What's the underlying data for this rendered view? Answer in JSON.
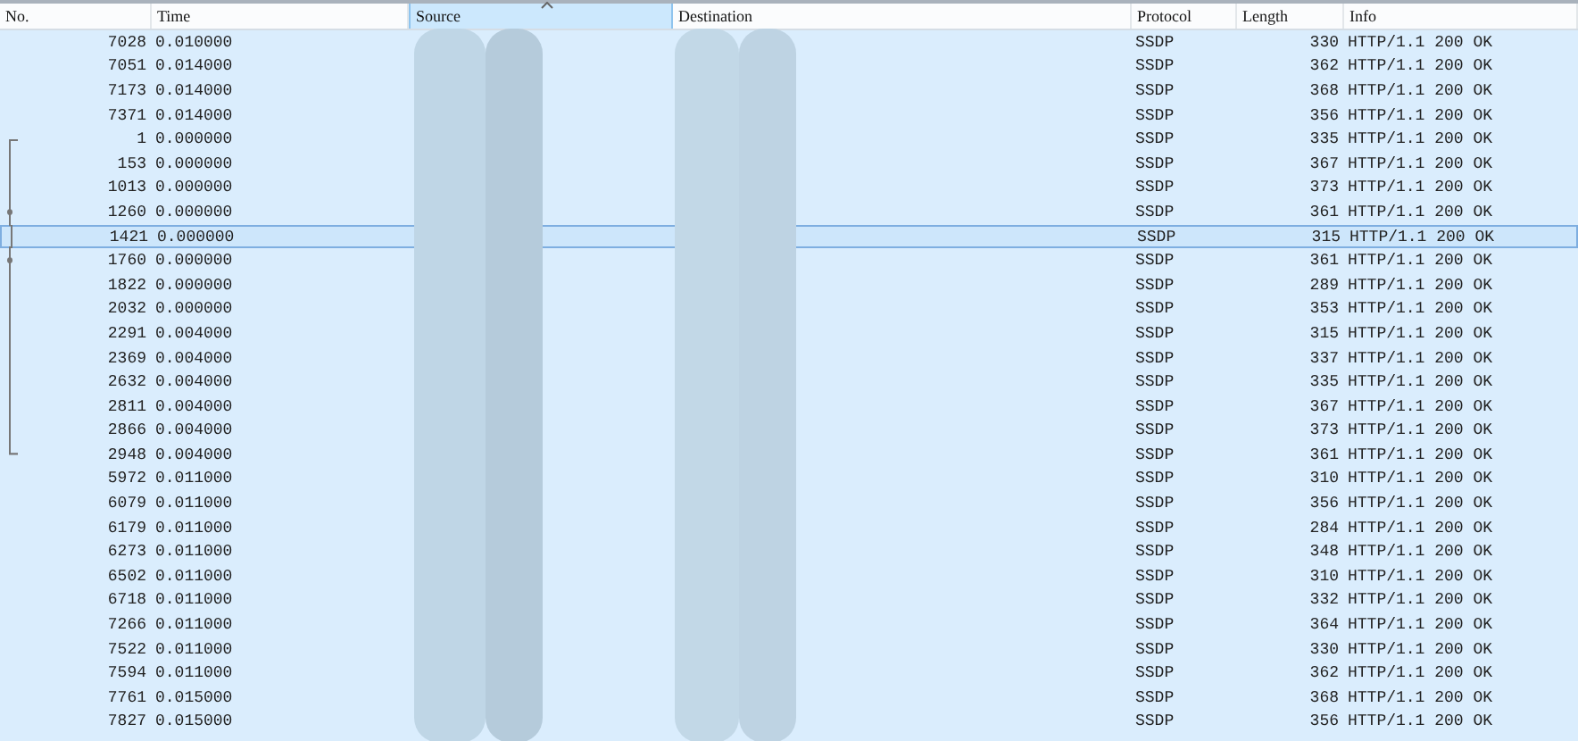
{
  "columns": [
    {
      "label": "No.",
      "sorted": false
    },
    {
      "label": "Time",
      "sorted": false
    },
    {
      "label": "Source",
      "sorted": true
    },
    {
      "label": "Destination",
      "sorted": false
    },
    {
      "label": "Protocol",
      "sorted": false
    },
    {
      "label": "Length",
      "sorted": false
    },
    {
      "label": "Info",
      "sorted": false
    }
  ],
  "rows": [
    {
      "no": "7028",
      "time": "0.010000",
      "protocol": "SSDP",
      "length": "330",
      "info": "HTTP/1.1 200 OK",
      "selected": false,
      "kind": "plain"
    },
    {
      "no": "7051",
      "time": "0.014000",
      "protocol": "SSDP",
      "length": "362",
      "info": "HTTP/1.1 200 OK",
      "selected": false,
      "kind": "plain"
    },
    {
      "no": "7173",
      "time": "0.014000",
      "protocol": "SSDP",
      "length": "368",
      "info": "HTTP/1.1 200 OK",
      "selected": false,
      "kind": "plain"
    },
    {
      "no": "7371",
      "time": "0.014000",
      "protocol": "SSDP",
      "length": "356",
      "info": "HTTP/1.1 200 OK",
      "selected": false,
      "kind": "plain"
    },
    {
      "no": "1",
      "time": "0.000000",
      "protocol": "SSDP",
      "length": "335",
      "info": "HTTP/1.1 200 OK",
      "selected": false,
      "kind": "start"
    },
    {
      "no": "153",
      "time": "0.000000",
      "protocol": "SSDP",
      "length": "367",
      "info": "HTTP/1.1 200 OK",
      "selected": false,
      "kind": "middle"
    },
    {
      "no": "1013",
      "time": "0.000000",
      "protocol": "SSDP",
      "length": "373",
      "info": "HTTP/1.1 200 OK",
      "selected": false,
      "kind": "middle"
    },
    {
      "no": "1260",
      "time": "0.000000",
      "protocol": "SSDP",
      "length": "361",
      "info": "HTTP/1.1 200 OK",
      "selected": false,
      "kind": "dot"
    },
    {
      "no": "1421",
      "time": "0.000000",
      "protocol": "SSDP",
      "length": "315",
      "info": "HTTP/1.1 200 OK",
      "selected": true,
      "kind": "middle"
    },
    {
      "no": "1760",
      "time": "0.000000",
      "protocol": "SSDP",
      "length": "361",
      "info": "HTTP/1.1 200 OK",
      "selected": false,
      "kind": "dot"
    },
    {
      "no": "1822",
      "time": "0.000000",
      "protocol": "SSDP",
      "length": "289",
      "info": "HTTP/1.1 200 OK",
      "selected": false,
      "kind": "middle"
    },
    {
      "no": "2032",
      "time": "0.000000",
      "protocol": "SSDP",
      "length": "353",
      "info": "HTTP/1.1 200 OK",
      "selected": false,
      "kind": "middle"
    },
    {
      "no": "2291",
      "time": "0.004000",
      "protocol": "SSDP",
      "length": "315",
      "info": "HTTP/1.1 200 OK",
      "selected": false,
      "kind": "middle"
    },
    {
      "no": "2369",
      "time": "0.004000",
      "protocol": "SSDP",
      "length": "337",
      "info": "HTTP/1.1 200 OK",
      "selected": false,
      "kind": "middle"
    },
    {
      "no": "2632",
      "time": "0.004000",
      "protocol": "SSDP",
      "length": "335",
      "info": "HTTP/1.1 200 OK",
      "selected": false,
      "kind": "middle"
    },
    {
      "no": "2811",
      "time": "0.004000",
      "protocol": "SSDP",
      "length": "367",
      "info": "HTTP/1.1 200 OK",
      "selected": false,
      "kind": "middle"
    },
    {
      "no": "2866",
      "time": "0.004000",
      "protocol": "SSDP",
      "length": "373",
      "info": "HTTP/1.1 200 OK",
      "selected": false,
      "kind": "middle"
    },
    {
      "no": "2948",
      "time": "0.004000",
      "protocol": "SSDP",
      "length": "361",
      "info": "HTTP/1.1 200 OK",
      "selected": false,
      "kind": "end"
    },
    {
      "no": "5972",
      "time": "0.011000",
      "protocol": "SSDP",
      "length": "310",
      "info": "HTTP/1.1 200 OK",
      "selected": false,
      "kind": "plain"
    },
    {
      "no": "6079",
      "time": "0.011000",
      "protocol": "SSDP",
      "length": "356",
      "info": "HTTP/1.1 200 OK",
      "selected": false,
      "kind": "plain"
    },
    {
      "no": "6179",
      "time": "0.011000",
      "protocol": "SSDP",
      "length": "284",
      "info": "HTTP/1.1 200 OK",
      "selected": false,
      "kind": "plain"
    },
    {
      "no": "6273",
      "time": "0.011000",
      "protocol": "SSDP",
      "length": "348",
      "info": "HTTP/1.1 200 OK",
      "selected": false,
      "kind": "plain"
    },
    {
      "no": "6502",
      "time": "0.011000",
      "protocol": "SSDP",
      "length": "310",
      "info": "HTTP/1.1 200 OK",
      "selected": false,
      "kind": "plain"
    },
    {
      "no": "6718",
      "time": "0.011000",
      "protocol": "SSDP",
      "length": "332",
      "info": "HTTP/1.1 200 OK",
      "selected": false,
      "kind": "plain"
    },
    {
      "no": "7266",
      "time": "0.011000",
      "protocol": "SSDP",
      "length": "364",
      "info": "HTTP/1.1 200 OK",
      "selected": false,
      "kind": "plain"
    },
    {
      "no": "7522",
      "time": "0.011000",
      "protocol": "SSDP",
      "length": "330",
      "info": "HTTP/1.1 200 OK",
      "selected": false,
      "kind": "plain"
    },
    {
      "no": "7594",
      "time": "0.011000",
      "protocol": "SSDP",
      "length": "362",
      "info": "HTTP/1.1 200 OK",
      "selected": false,
      "kind": "plain"
    },
    {
      "no": "7761",
      "time": "0.015000",
      "protocol": "SSDP",
      "length": "368",
      "info": "HTTP/1.1 200 OK",
      "selected": false,
      "kind": "plain"
    },
    {
      "no": "7827",
      "time": "0.015000",
      "protocol": "SSDP",
      "length": "356",
      "info": "HTTP/1.1 200 OK",
      "selected": false,
      "kind": "plain"
    }
  ]
}
